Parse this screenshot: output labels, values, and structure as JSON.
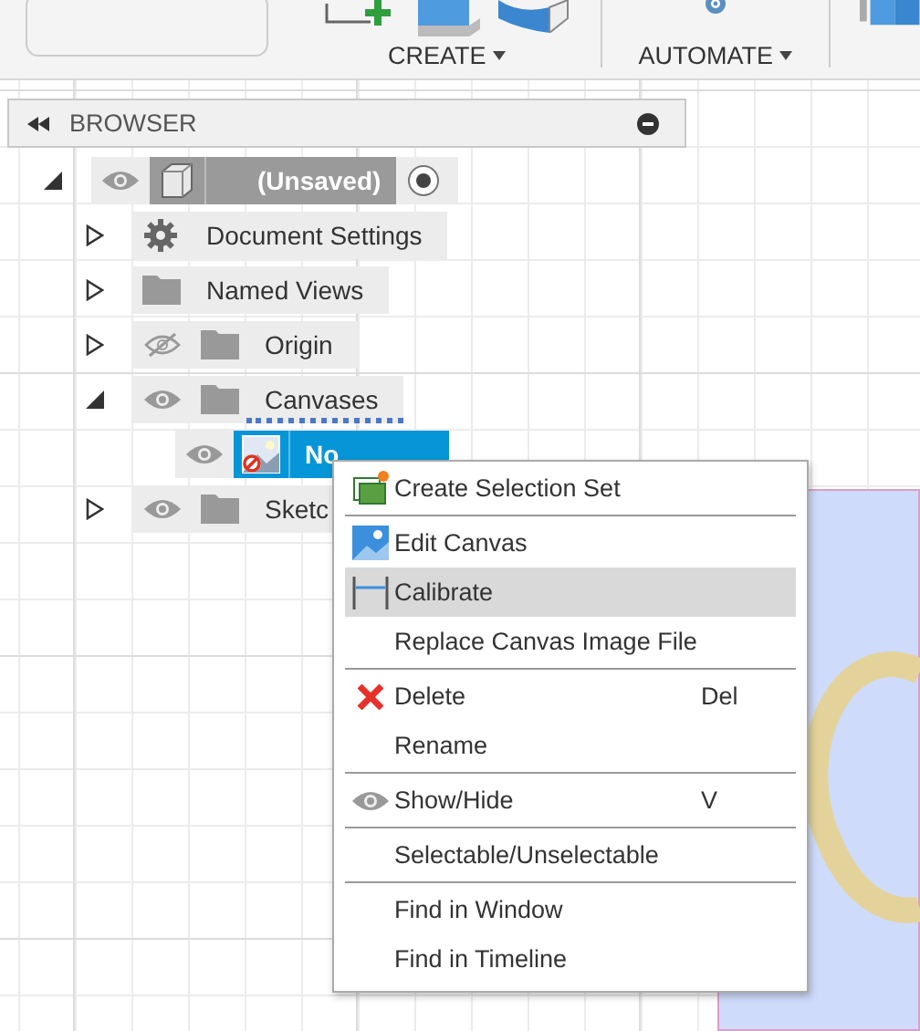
{
  "toolbar": {
    "groups": [
      {
        "kind": "create",
        "label": "CREATE"
      },
      {
        "kind": "automate",
        "label": "AUTOMATE"
      }
    ]
  },
  "browser": {
    "title": "BROWSER"
  },
  "tree": {
    "label": "(Unsaved)",
    "kind": "component",
    "expanded": true,
    "visible": true,
    "selected": false,
    "active": true,
    "flagged": false,
    "children": [
      {
        "label": "Document Settings",
        "kind": "settings",
        "expanded": false,
        "selected": false,
        "flagged": false
      },
      {
        "label": "Named Views",
        "kind": "folder",
        "expanded": false,
        "selected": false,
        "flagged": false
      },
      {
        "label": "Origin",
        "kind": "folder",
        "expanded": false,
        "visible": false,
        "selected": false,
        "flagged": false
      },
      {
        "label": "Canvases",
        "kind": "folder",
        "expanded": true,
        "visible": true,
        "selected": false,
        "flagged": true,
        "children": [
          {
            "label": "No",
            "kind": "canvas",
            "visible": true,
            "selected": true,
            "flagged": false
          }
        ]
      },
      {
        "label": "Sketc",
        "kind": "folder",
        "expanded": false,
        "visible": true,
        "selected": false,
        "flagged": false
      }
    ]
  },
  "context_menu": {
    "groups": [
      [
        {
          "label": "Create Selection Set",
          "kind": "selection-set",
          "selected": false
        }
      ],
      [
        {
          "label": "Edit Canvas",
          "kind": "edit-image",
          "selected": false
        },
        {
          "label": "Calibrate",
          "kind": "calibrate",
          "selected": true
        },
        {
          "label": "Replace Canvas Image File",
          "kind": "plain",
          "selected": false
        }
      ],
      [
        {
          "label": "Delete",
          "kind": "delete",
          "shortcut": "Del",
          "selected": false
        },
        {
          "label": "Rename",
          "kind": "plain",
          "selected": false
        }
      ],
      [
        {
          "label": "Show/Hide",
          "kind": "visibility",
          "shortcut": "V",
          "selected": false
        }
      ],
      [
        {
          "label": "Selectable/Unselectable",
          "kind": "plain",
          "selected": false
        }
      ],
      [
        {
          "label": "Find in Window",
          "kind": "plain",
          "selected": false
        },
        {
          "label": "Find in Timeline",
          "kind": "plain",
          "selected": false
        }
      ]
    ]
  }
}
